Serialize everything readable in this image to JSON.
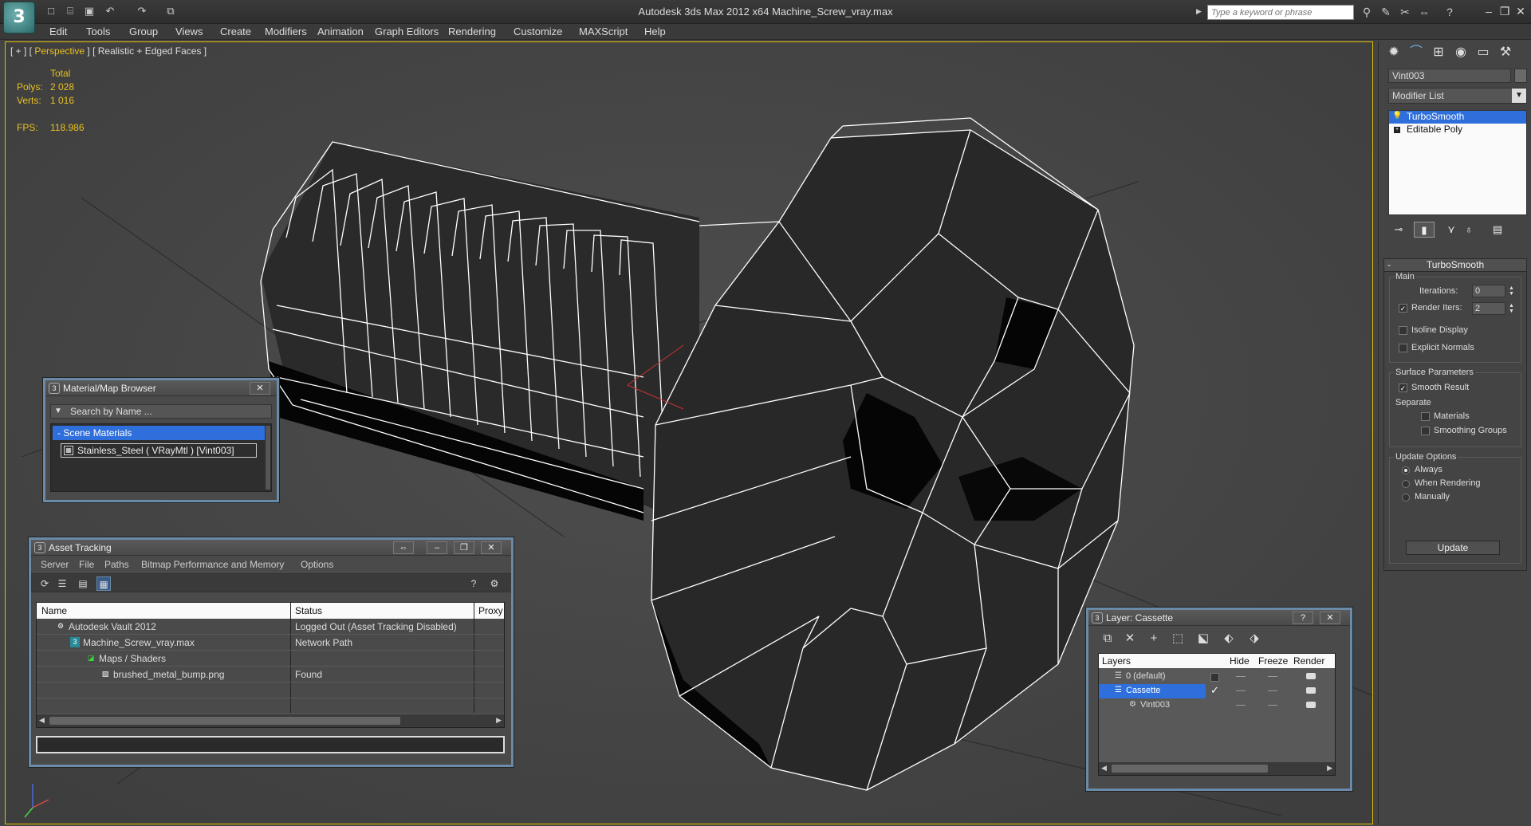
{
  "titlebar": {
    "logo": "3",
    "title": "Autodesk 3ds Max  2012 x64      Machine_Screw_vray.max",
    "search_placeholder": "Type a keyword or phrase",
    "quick_access_icons": [
      "new-file-icon",
      "open-file-icon",
      "save-icon",
      "undo-icon",
      "redo-icon",
      "project-folder-icon"
    ],
    "tool_icons": [
      "binoculars-icon",
      "tools-icon",
      "favorites-icon",
      "swap-icon",
      "help-icon"
    ],
    "window_controls": [
      "minimize-icon",
      "restore-icon",
      "close-icon"
    ]
  },
  "menubar": {
    "items": [
      "Edit",
      "Tools",
      "Group",
      "Views",
      "Create",
      "Modifiers",
      "Animation",
      "Graph Editors",
      "Rendering",
      "Customize",
      "MAXScript",
      "Help"
    ]
  },
  "viewport": {
    "label_prefix": "[ + ] [ ",
    "label_view": "Perspective",
    "label_suffix": " ] [ Realistic + Edged Faces ]",
    "stats": {
      "total_label": "Total",
      "polys_label": "Polys:",
      "polys_value": "2 028",
      "verts_label": "Verts:",
      "verts_value": "1 016",
      "fps_label": "FPS:",
      "fps_value": "118.986"
    }
  },
  "command_panel": {
    "tab_icons": [
      "create-icon",
      "modify-icon",
      "hierarchy-icon",
      "motion-icon",
      "display-icon",
      "utilities-icon"
    ],
    "object_name": "Vint003",
    "modifier_list_label": "Modifier List",
    "stack": [
      {
        "label": "TurboSmooth",
        "selected": true
      },
      {
        "label": "Editable Poly",
        "selected": false
      }
    ],
    "stack_buttons": [
      "pin-stack-icon",
      "show-end-result-icon",
      "make-unique-icon",
      "remove-modifier-icon",
      "configure-sets-icon"
    ],
    "turbosmooth": {
      "title": "TurboSmooth",
      "main_label": "Main",
      "iterations_label": "Iterations:",
      "iterations_value": "0",
      "render_iters_label": "Render Iters:",
      "render_iters_value": "2",
      "render_iters_checked": true,
      "isoline_label": "Isoline Display",
      "explicit_normals_label": "Explicit Normals",
      "surface_label": "Surface Parameters",
      "smooth_result_label": "Smooth Result",
      "smooth_result_checked": true,
      "separate_label": "Separate",
      "materials_label": "Materials",
      "smoothing_groups_label": "Smoothing Groups",
      "update_options_label": "Update Options",
      "always_label": "Always",
      "when_rendering_label": "When Rendering",
      "manually_label": "Manually",
      "update_button": "Update"
    }
  },
  "material_browser": {
    "title": "Material/Map Browser",
    "search_placeholder": "Search by Name ...",
    "group_label": "- Scene Materials",
    "item_label": "Stainless_Steel  ( VRayMtl )  [Vint003]"
  },
  "asset_tracking": {
    "title": "Asset Tracking",
    "menu": [
      "Server",
      "File",
      "Paths",
      "Bitmap Performance and Memory",
      "Options"
    ],
    "columns": [
      "Name",
      "Status",
      "Proxy"
    ],
    "rows": [
      {
        "name": "Autodesk Vault 2012",
        "status": "Logged Out (Asset Tracking Disabled)",
        "icon": "vault-icon",
        "indent": 1
      },
      {
        "name": "Machine_Screw_vray.max",
        "status": "Network Path",
        "icon": "max-file-icon",
        "indent": 2
      },
      {
        "name": "Maps / Shaders",
        "status": "",
        "icon": "maps-folder-icon",
        "indent": 3
      },
      {
        "name": "brushed_metal_bump.png",
        "status": "Found",
        "icon": "image-file-icon",
        "indent": 4
      }
    ]
  },
  "layer_window": {
    "title": "Layer: Cassette",
    "help": "?",
    "columns": [
      "Layers",
      "Hide",
      "Freeze",
      "Render"
    ],
    "rows": [
      {
        "name": "0 (default)",
        "selected": false,
        "indent": 1
      },
      {
        "name": "Cassette",
        "selected": true,
        "indent": 1
      },
      {
        "name": "Vint003",
        "selected": false,
        "indent": 2
      }
    ]
  },
  "colors": {
    "accent_blue": "#2e6fdc",
    "viewport_highlight": "#e8c020",
    "viewport_bg": "#464646"
  }
}
